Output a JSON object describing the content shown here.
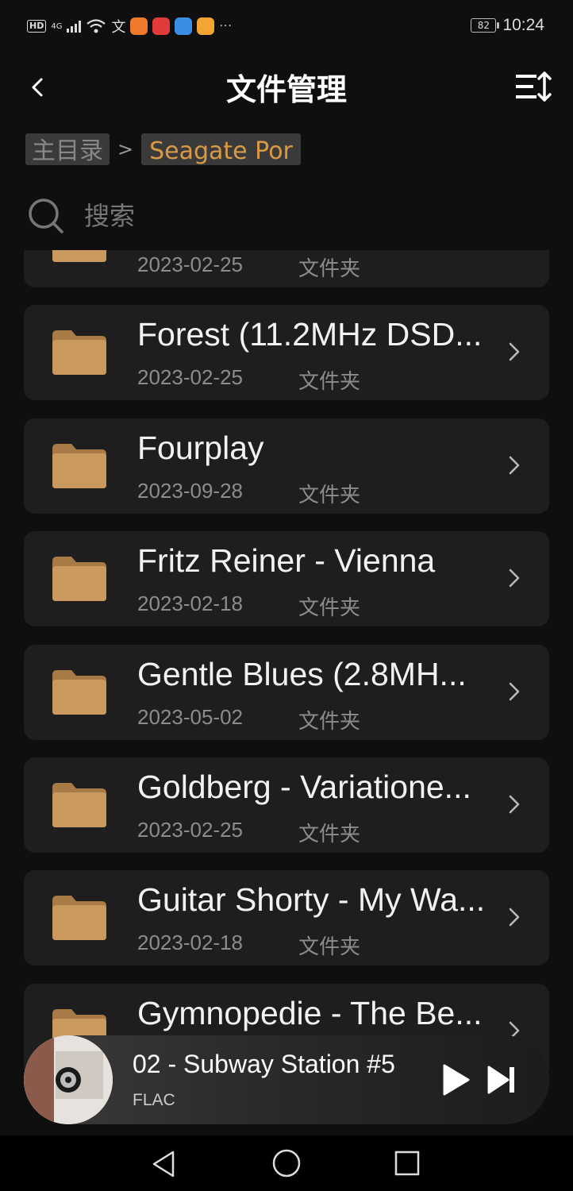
{
  "status": {
    "network": "4G",
    "battery": "82",
    "time": "10:24"
  },
  "header": {
    "title": "文件管理"
  },
  "breadcrumb": {
    "root": "主目录",
    "separator": ">",
    "current": "Seagate Por"
  },
  "search": {
    "placeholder": "搜索"
  },
  "folders": [
    {
      "name": "",
      "date": "2023-02-25",
      "kind": "文件夹"
    },
    {
      "name": "Forest (11.2MHz DSD...",
      "date": "2023-02-25",
      "kind": "文件夹"
    },
    {
      "name": "Fourplay",
      "date": "2023-09-28",
      "kind": "文件夹"
    },
    {
      "name": "Fritz Reiner - Vienna",
      "date": "2023-02-18",
      "kind": "文件夹"
    },
    {
      "name": "Gentle Blues (2.8MH...",
      "date": "2023-05-02",
      "kind": "文件夹"
    },
    {
      "name": "Goldberg - Variatione...",
      "date": "2023-02-25",
      "kind": "文件夹"
    },
    {
      "name": "Guitar Shorty - My Wa...",
      "date": "2023-02-18",
      "kind": "文件夹"
    },
    {
      "name": "Gymnopedie - The Be...",
      "date": "",
      "kind": ""
    }
  ],
  "player": {
    "track": "02 - Subway Station #5",
    "format": "FLAC"
  },
  "colors": {
    "accent": "#d99a45",
    "folder": "#c9995e",
    "card": "#1e1e1e",
    "background": "#0f0f0f"
  }
}
